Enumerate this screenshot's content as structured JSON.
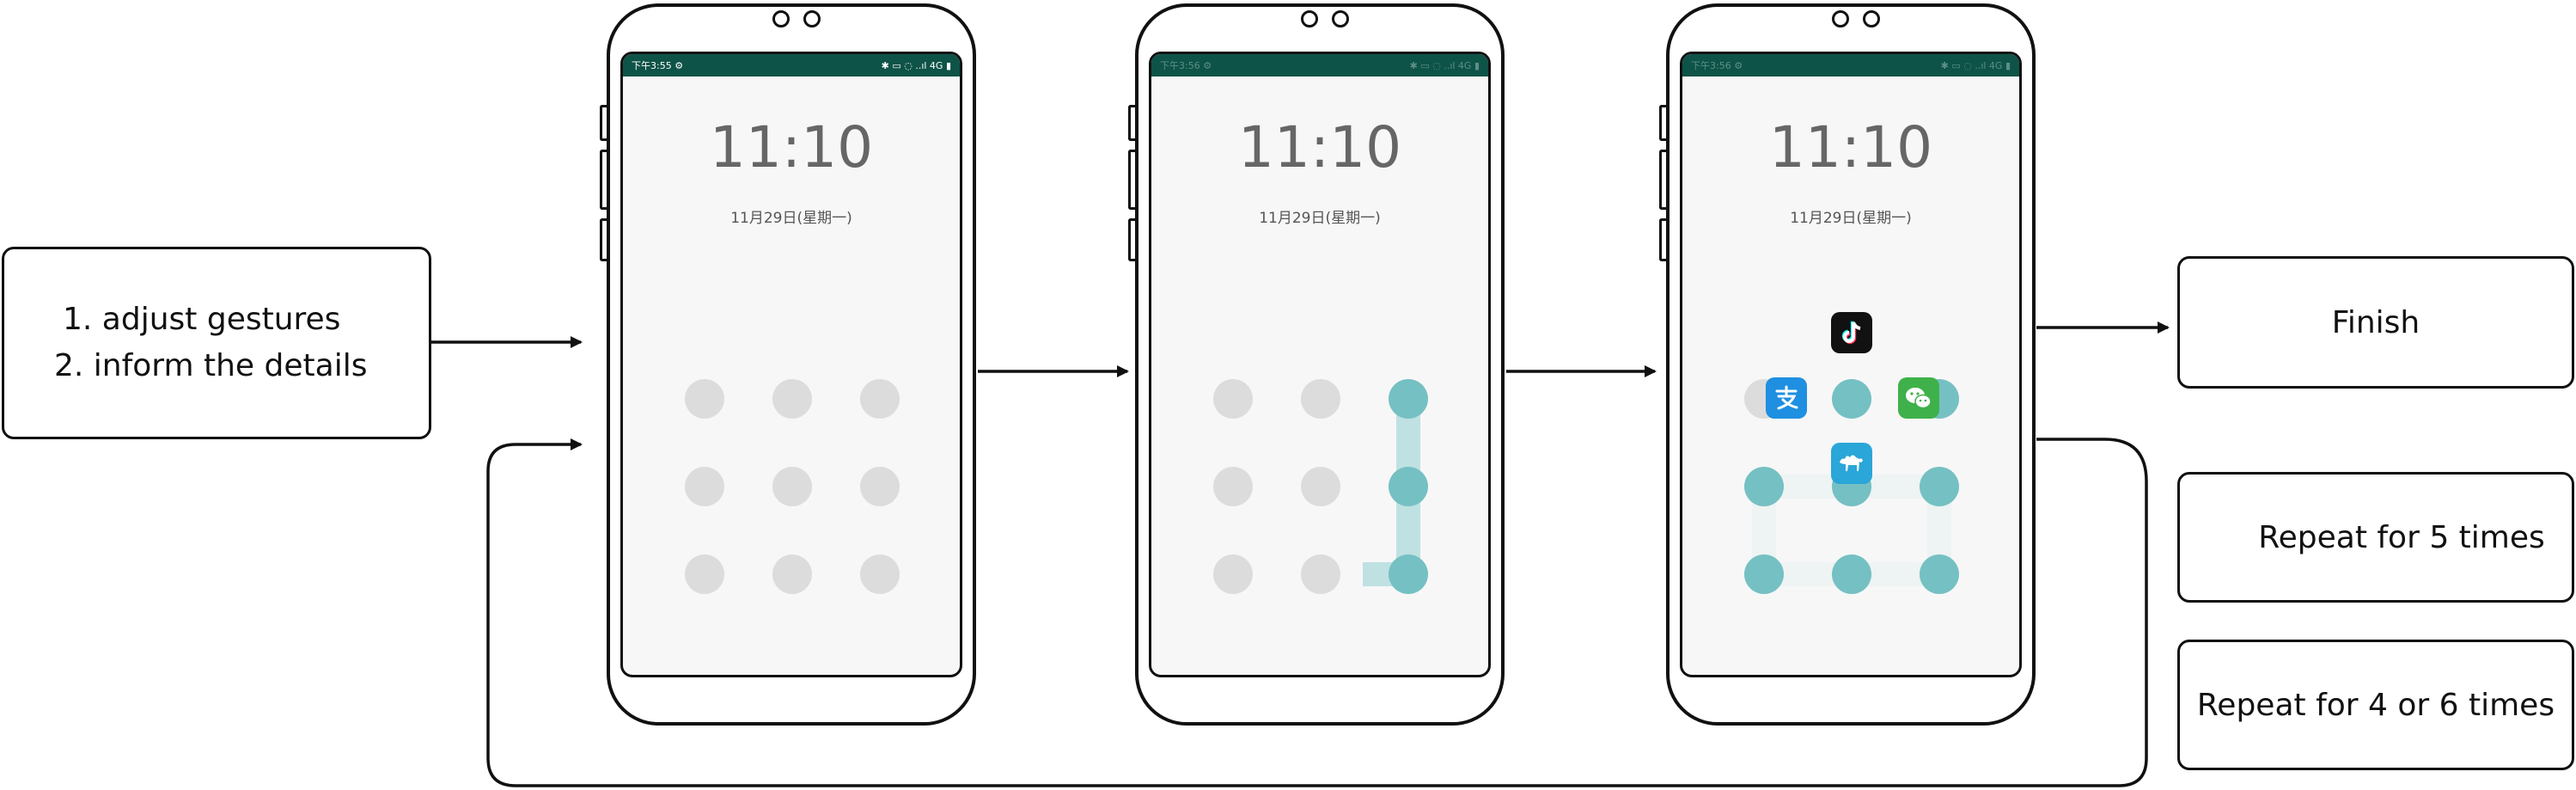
{
  "instructions": {
    "line1": "1. adjust gestures",
    "line2": "2. inform the details"
  },
  "outcomes": {
    "finish": "Finish",
    "repeat5": "Repeat for 5 times",
    "repeat46": "Repeat for 4 or 6 times"
  },
  "phones": [
    {
      "status_left": "下午3:55 ⚙",
      "status_right": "✱ ▭ ◌ ..ıl 4G ▮",
      "time": "11:10",
      "date": "11月29日(星期一)"
    },
    {
      "status_left": "下午3:56 ⚙",
      "status_right": "✱ ▭ ◌ ..ıl 4G ▮",
      "time": "11:10",
      "date": "11月29日(星期一)"
    },
    {
      "status_left": "下午3:56 ⚙",
      "status_right": "✱ ▭ ◌ ..ıl 4G ▮",
      "time": "11:10",
      "date": "11月29日(星期一)"
    }
  ],
  "colors": {
    "dot_inactive": "#dcdcdc",
    "dot_active": "#75c0c3",
    "trail": "#bfe1e2",
    "status_bar": "#0e5347",
    "tiktok": "#111111",
    "alipay": "#1e8fe1",
    "wechat": "#3fb14a",
    "camel": "#2aa6d8"
  },
  "icons": [
    "tiktok-icon",
    "alipay-icon",
    "wechat-icon",
    "camel-icon"
  ]
}
